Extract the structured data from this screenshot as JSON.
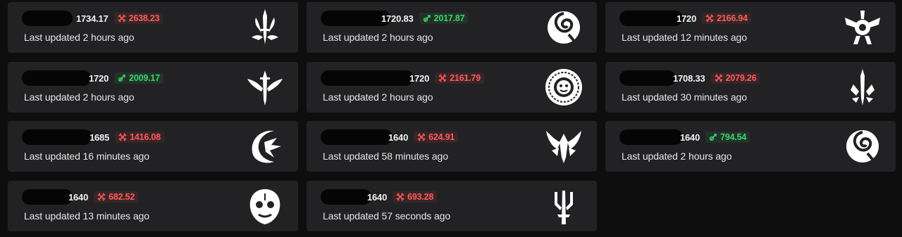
{
  "cards": [
    {
      "score": "1734.17",
      "delta": "2638.23",
      "delta_type": "neg",
      "updated": "Last updated 2 hours ago",
      "emblem": "sword-crest-icon"
    },
    {
      "score": "1720.83",
      "delta": "2017.87",
      "delta_type": "pos",
      "updated": "Last updated 2 hours ago",
      "emblem": "swirl-q-icon"
    },
    {
      "score": "1720",
      "delta": "2166.94",
      "delta_type": "neg",
      "updated": "Last updated 12 minutes ago",
      "emblem": "gear-wings-icon"
    },
    {
      "score": "1720",
      "delta": "2009.17",
      "delta_type": "pos",
      "updated": "Last updated 2 hours ago",
      "emblem": "winged-sword-icon"
    },
    {
      "score": "1720",
      "delta": "2161.79",
      "delta_type": "neg",
      "updated": "Last updated 2 hours ago",
      "emblem": "mandala-face-icon"
    },
    {
      "score": "1708.33",
      "delta": "2079.26",
      "delta_type": "neg",
      "updated": "Last updated 30 minutes ago",
      "emblem": "thorned-sword-icon"
    },
    {
      "score": "1685",
      "delta": "1416.08",
      "delta_type": "neg",
      "updated": "Last updated 16 minutes ago",
      "emblem": "crescent-dragon-icon"
    },
    {
      "score": "1640",
      "delta": "624.91",
      "delta_type": "neg",
      "updated": "Last updated 58 minutes ago",
      "emblem": "demon-wings-icon"
    },
    {
      "score": "1640",
      "delta": "794.54",
      "delta_type": "pos",
      "updated": "Last updated 2 hours ago",
      "emblem": "swirl-q-icon"
    },
    {
      "score": "1640",
      "delta": "682.52",
      "delta_type": "neg",
      "updated": "Last updated 13 minutes ago",
      "emblem": "ornate-mask-icon"
    },
    {
      "score": "1640",
      "delta": "693.28",
      "delta_type": "neg",
      "updated": "Last updated 57 seconds ago",
      "emblem": "trident-icon"
    }
  ],
  "colors": {
    "negative": "#ff5a5a",
    "positive": "#3ad36a",
    "card": "#222224",
    "background": "#0e0e0f"
  }
}
